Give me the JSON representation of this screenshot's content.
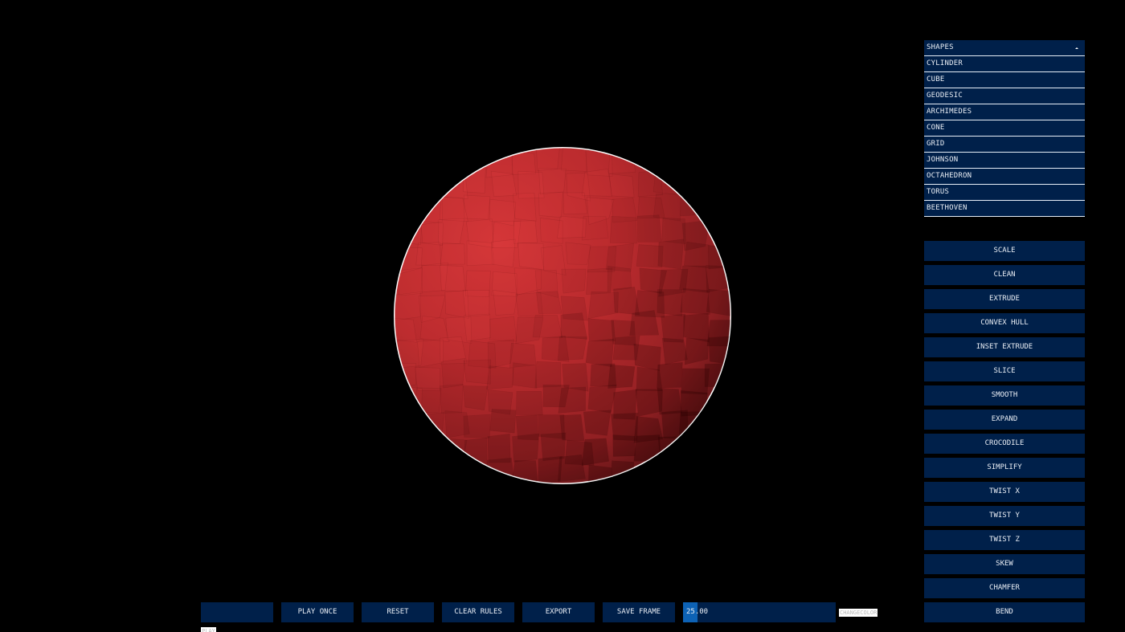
{
  "viewport": {
    "object": "red faceted sphere",
    "color": "#c0282b"
  },
  "shapes": {
    "header": "SHAPES",
    "items": [
      "CYLINDER",
      "CUBE",
      "GEODESIC",
      "ARCHIMEDES",
      "CONE",
      "GRID",
      "JOHNSON",
      "OCTAHEDRON",
      "TORUS",
      "BEETHOVEN"
    ]
  },
  "operations": [
    "SCALE",
    "CLEAN",
    "EXTRUDE",
    "CONVEX HULL",
    "INSET EXTRUDE",
    "SLICE",
    "SMOOTH",
    "EXPAND",
    "CROCODILE",
    "SIMPLIFY",
    "TWIST X",
    "TWIST Y",
    "TWIST Z",
    "SKEW",
    "CHAMFER",
    "BEND"
  ],
  "toolbar": {
    "blank_label": "",
    "play_once": "PLAY ONCE",
    "reset": "RESET",
    "clear_rules": "CLEAR RULES",
    "export": "EXPORT",
    "save_frame": "SAVE FRAME",
    "slider_value": "25.00",
    "change_color": "CHANGECOLOR",
    "play": "PLAY"
  },
  "colors": {
    "panel": "#00204a",
    "slider_fill": "#0d62b5",
    "background": "#000000"
  }
}
